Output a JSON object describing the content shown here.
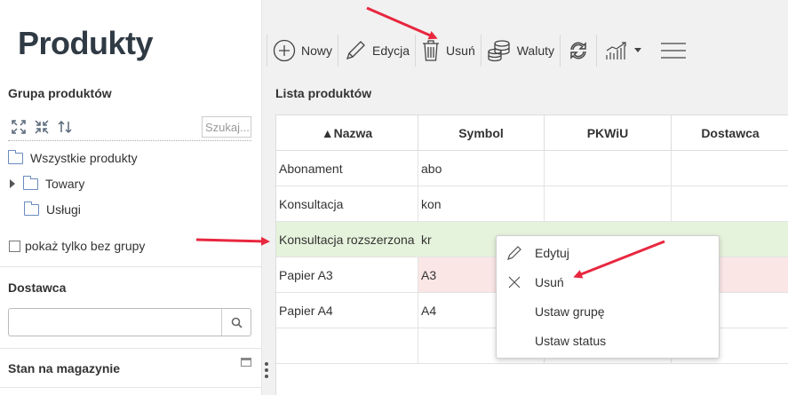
{
  "page": {
    "title": "Produkty"
  },
  "left": {
    "group_section": {
      "title": "Grupa produktów",
      "search_placeholder": "Szukaj...",
      "tree": [
        {
          "label": "Wszystkie produkty"
        },
        {
          "label": "Towary"
        },
        {
          "label": "Usługi"
        }
      ],
      "only_without_group": "pokaż tylko bez grupy"
    },
    "supplier_section": {
      "title": "Dostawca",
      "input_value": ""
    },
    "stock_section": {
      "title": "Stan na magazynie"
    }
  },
  "toolbar": {
    "new_label": "Nowy",
    "edit_label": "Edycja",
    "delete_label": "Usuń",
    "currencies_label": "Waluty"
  },
  "list": {
    "title": "Lista produktów",
    "columns": [
      "▲Nazwa",
      "Symbol",
      "PKWiU",
      "Dostawca"
    ],
    "rows": [
      {
        "name": "Abonament",
        "symbol": "abo"
      },
      {
        "name": "Konsultacja",
        "symbol": "kon"
      },
      {
        "name": "Konsultacja rozszerzona",
        "symbol": "kr"
      },
      {
        "name": "Papier A3",
        "symbol": "A3"
      },
      {
        "name": "Papier A4",
        "symbol": "A4"
      }
    ]
  },
  "context_menu": {
    "items": [
      "Edytuj",
      "Usuń",
      "Ustaw grupę",
      "Ustaw status"
    ]
  },
  "colors": {
    "selected_row": "#e6f3dc",
    "highlight_row": "#fbe6e6",
    "annotation_arrow": "#e8273f",
    "folder": "#6a8bbf"
  }
}
